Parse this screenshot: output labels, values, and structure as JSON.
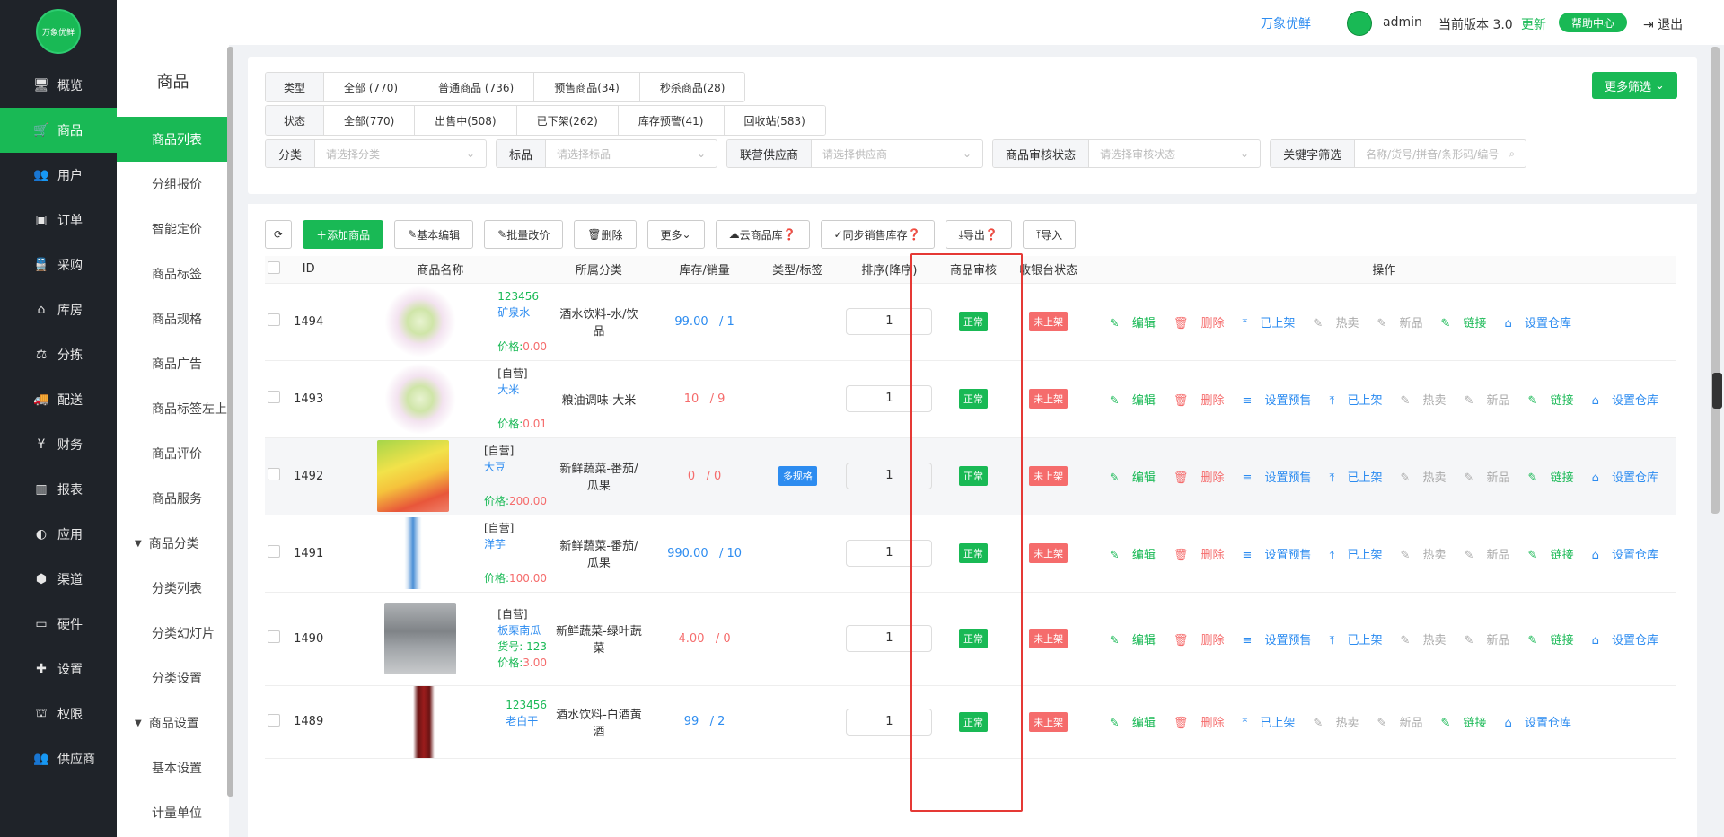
{
  "brand": {
    "logo_text": "万象优鲜"
  },
  "nav": [
    {
      "icon": "monitor-icon",
      "label": "概览"
    },
    {
      "icon": "cart-icon",
      "label": "商品",
      "active": true
    },
    {
      "icon": "users-icon",
      "label": "用户"
    },
    {
      "icon": "order-icon",
      "label": "订单"
    },
    {
      "icon": "truck-icon",
      "label": "采购"
    },
    {
      "icon": "home-icon",
      "label": "库房"
    },
    {
      "icon": "scale-icon",
      "label": "分拣"
    },
    {
      "icon": "delivery-icon",
      "label": "配送"
    },
    {
      "icon": "yen-icon",
      "label": "财务"
    },
    {
      "icon": "chart-icon",
      "label": "报表"
    },
    {
      "icon": "app-icon",
      "label": "应用"
    },
    {
      "icon": "cube-icon",
      "label": "渠道"
    },
    {
      "icon": "hardware-icon",
      "label": "硬件"
    },
    {
      "icon": "puzzle-icon",
      "label": "设置"
    },
    {
      "icon": "bank-icon",
      "label": "权限"
    },
    {
      "icon": "supplier-icon",
      "label": "供应商"
    }
  ],
  "subnav": {
    "title": "商品",
    "items": [
      {
        "label": "商品列表",
        "active": true
      },
      {
        "label": "分组报价"
      },
      {
        "label": "智能定价"
      },
      {
        "label": "商品标签"
      },
      {
        "label": "商品规格"
      },
      {
        "label": "商品广告"
      },
      {
        "label": "商品标签左上"
      },
      {
        "label": "商品评价"
      },
      {
        "label": "商品服务"
      },
      {
        "label": "商品分类",
        "group": true
      },
      {
        "label": "分类列表"
      },
      {
        "label": "分类幻灯片"
      },
      {
        "label": "分类设置"
      },
      {
        "label": "商品设置",
        "group": true
      },
      {
        "label": "基本设置"
      },
      {
        "label": "计量单位"
      }
    ]
  },
  "topbar": {
    "brand": "万象优鲜",
    "user": "admin",
    "version": "当前版本  3.0",
    "update": "更新",
    "help": "帮助中心",
    "logout": "退出"
  },
  "filters": {
    "type": {
      "label": "类型",
      "options": [
        "全部 (770)",
        "普通商品 (736)",
        "预售商品(34)",
        "秒杀商品(28)"
      ]
    },
    "status": {
      "label": "状态",
      "options": [
        "全部(770)",
        "出售中(508)",
        "已下架(262)",
        "库存预警(41)",
        "回收站(583)"
      ]
    },
    "selects": [
      {
        "label": "分类",
        "placeholder": "请选择分类"
      },
      {
        "label": "标品",
        "placeholder": "请选择标品"
      },
      {
        "label": "联营供应商",
        "placeholder": "请选择供应商"
      },
      {
        "label": "商品审核状态",
        "placeholder": "请选择审核状态"
      },
      {
        "label": "关键字筛选",
        "placeholder": "名称/货号/拼音/条形码/编号"
      }
    ],
    "more": "更多筛选"
  },
  "toolbar": {
    "add": "添加商品",
    "edit": "基本编辑",
    "batch_price": "批量改价",
    "delete": "删除",
    "more": "更多",
    "cloud": "云商品库",
    "sync": "同步销售库存",
    "export": "导出",
    "import": "导入"
  },
  "table": {
    "headers": [
      "ID",
      "商品名称",
      "所属分类",
      "库存/销量",
      "类型/标签",
      "排序(降序)",
      "商品审核",
      "收银台状态",
      "操作"
    ],
    "rows": [
      {
        "id": "1494",
        "top": "123456",
        "top_kind": "code",
        "name": "矿泉水",
        "extra": "",
        "price_label": "价格:",
        "price": "0.00",
        "category": "酒水饮料-水/饮品",
        "stock": "99.00",
        "sales": "/ 1",
        "stock_color": "blue",
        "tag": "",
        "sort": "1",
        "audit": "正常",
        "pos": "未上架",
        "ops": [
          "编辑",
          "删除",
          "已上架",
          "热卖",
          "新品",
          "链接",
          "设置仓库"
        ],
        "img": "veg"
      },
      {
        "id": "1493",
        "top": "[自营]",
        "top_kind": "self",
        "name": "大米",
        "extra": "",
        "price_label": "价格:",
        "price": "0.01",
        "category": "粮油调味-大米",
        "stock": "10",
        "sales": "/ 9",
        "stock_color": "red",
        "tag": "",
        "sort": "1",
        "audit": "正常",
        "pos": "未上架",
        "ops": [
          "编辑",
          "删除",
          "设置预售",
          "已上架",
          "热卖",
          "新品",
          "链接",
          "设置仓库"
        ],
        "img": "veg"
      },
      {
        "id": "1492",
        "top": "[自营]",
        "top_kind": "self",
        "name": "大豆",
        "extra": "",
        "price_label": "价格:",
        "price": "200.00",
        "category": "新鲜蔬菜-番茄/瓜果",
        "stock": "0",
        "sales": "/ 0",
        "stock_color": "red",
        "tag": "多规格",
        "sort": "1",
        "audit": "正常",
        "pos": "未上架",
        "ops": [
          "编辑",
          "删除",
          "设置预售",
          "已上架",
          "热卖",
          "新品",
          "链接",
          "设置仓库"
        ],
        "img": "fruit",
        "hl": true
      },
      {
        "id": "1491",
        "top": "[自营]",
        "top_kind": "self",
        "name": "洋芋",
        "extra": "",
        "price_label": "价格:",
        "price": "100.00",
        "category": "新鲜蔬菜-番茄/瓜果",
        "stock": "990.00",
        "sales": "/ 10",
        "stock_color": "blue",
        "tag": "",
        "sort": "1",
        "audit": "正常",
        "pos": "未上架",
        "ops": [
          "编辑",
          "删除",
          "设置预售",
          "已上架",
          "热卖",
          "新品",
          "链接",
          "设置仓库"
        ],
        "img": "water"
      },
      {
        "id": "1490",
        "top": "[自营]",
        "top_kind": "self",
        "name": "板栗南瓜",
        "extra": "货号: 123",
        "price_label": "价格:",
        "price": "3.00",
        "category": "新鲜蔬菜-绿叶蔬菜",
        "stock": "4.00",
        "sales": "/ 0",
        "stock_color": "red",
        "tag": "",
        "sort": "1",
        "audit": "正常",
        "pos": "未上架",
        "ops": [
          "编辑",
          "删除",
          "设置预售",
          "已上架",
          "热卖",
          "新品",
          "链接",
          "设置仓库"
        ],
        "img": "blur"
      },
      {
        "id": "1489",
        "top": "123456",
        "top_kind": "code",
        "name": "老白干",
        "extra": "",
        "price_label": "",
        "price": "",
        "category": "酒水饮料-白酒黄酒",
        "stock": "99",
        "sales": "/ 2",
        "stock_color": "blue",
        "tag": "",
        "sort": "1",
        "audit": "正常",
        "pos": "未上架",
        "ops": [
          "编辑",
          "删除",
          "已上架",
          "热卖",
          "新品",
          "链接",
          "设置仓库"
        ],
        "img": "bottle"
      }
    ]
  },
  "colors": {
    "brand_green": "#19b955",
    "nav_bg": "#1f2329",
    "link_blue": "#2d8cf0",
    "danger_red": "#f56c6c",
    "highlight_box": "#e53935"
  }
}
